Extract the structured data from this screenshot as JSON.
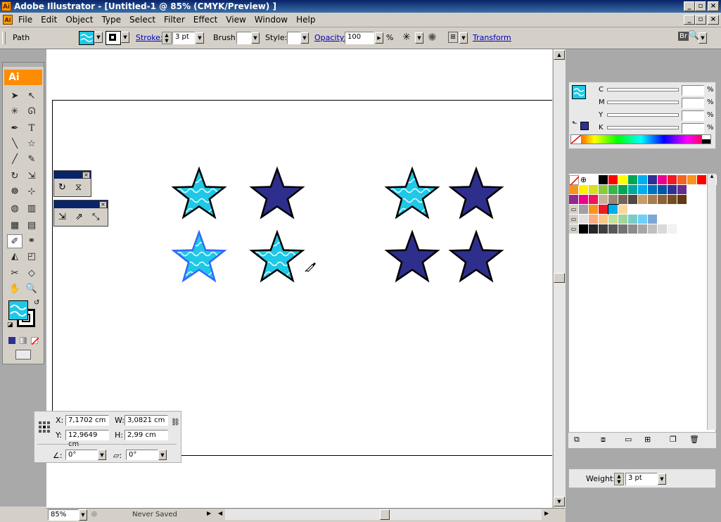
{
  "window": {
    "title": "Adobe Illustrator - [Untitled-1 @ 85% (CMYK/Preview) ]"
  },
  "menu": [
    "File",
    "Edit",
    "Object",
    "Type",
    "Select",
    "Filter",
    "Effect",
    "View",
    "Window",
    "Help"
  ],
  "control_bar": {
    "selection_label": "Path",
    "stroke_label": "Stroke:",
    "stroke_weight": "3 pt",
    "brush_label": "Brush:",
    "style_label": "Style:",
    "opacity_label": "Opacity:",
    "opacity_value": "100",
    "opacity_unit": "%",
    "transform_label": "Transform"
  },
  "transform_panel": {
    "x_label": "X:",
    "x_value": "7,1702 cm",
    "y_label": "Y:",
    "y_value": "12,9649 cm",
    "w_label": "W:",
    "w_value": "3,0821 cm",
    "h_label": "H:",
    "h_value": "2,99 cm",
    "rotate_value": "0°",
    "shear_value": "0°"
  },
  "color_panel": {
    "channels": [
      {
        "label": "C",
        "unit": "%"
      },
      {
        "label": "M",
        "unit": "%"
      },
      {
        "label": "Y",
        "unit": "%"
      },
      {
        "label": "K",
        "unit": "%"
      }
    ]
  },
  "stroke_panel": {
    "weight_label": "Weight:",
    "weight_value": "3 pt"
  },
  "status_bar": {
    "zoom": "85%",
    "status": "Never Saved"
  },
  "colors": {
    "star_navy": "#2e2e8c",
    "star_cyan": "#1ec8e6",
    "star_pattern": "#e8fbff",
    "selection": "#3366ff"
  },
  "swatch_rows": [
    [
      "#ffffff",
      "#000000",
      "#ff0000",
      "#ffff00",
      "#00a651",
      "#00aeef",
      "#2e3192",
      "#ec008c",
      "#ed1c24",
      "#f26522",
      "#f7941d",
      "#ff0000",
      "#ed1c24"
    ],
    [
      "#f7941d",
      "#fff200",
      "#d7df23",
      "#8dc63f",
      "#39b54a",
      "#00a651",
      "#00a99d",
      "#00aeef",
      "#0072bc",
      "#0054a6",
      "#2e3192",
      "#662d91"
    ],
    [
      "#92278f",
      "#ec008c",
      "#ed145b",
      "#c7b299",
      "#998675",
      "#736357",
      "#534741",
      "#c69c6d",
      "#a67c52",
      "#8c6239",
      "#754c24",
      "#603913"
    ],
    [
      "#a0a0a0",
      "#f7941d",
      "#ed1c24",
      "#00aeef",
      "#fbd7a0"
    ],
    [
      "#e0e0e0",
      "#f9ad81",
      "#fdc68a",
      "#c4df9b",
      "#a3d39c",
      "#7accc8",
      "#6dcff6",
      "#7da7d9"
    ],
    [
      "#000000",
      "#262626",
      "#404040",
      "#595959",
      "#737373",
      "#8c8c8c",
      "#a6a6a6",
      "#bfbfbf",
      "#d9d9d9",
      "#f2f2f2"
    ]
  ]
}
